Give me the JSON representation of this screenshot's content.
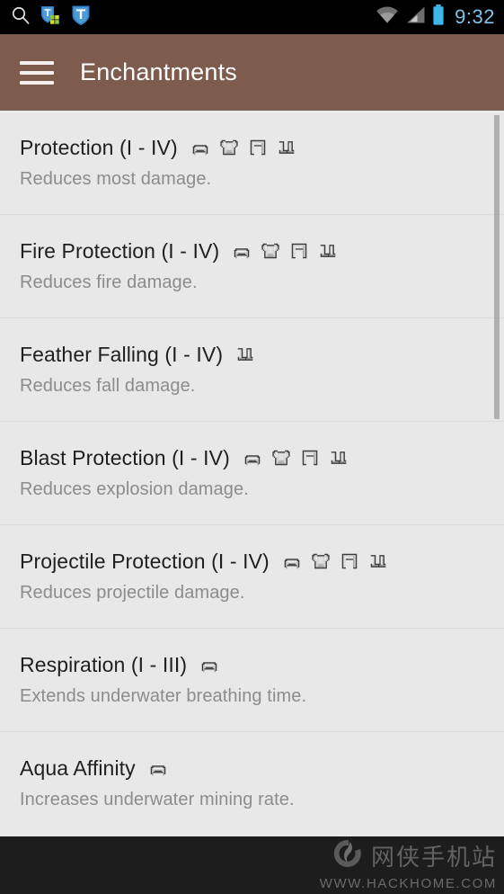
{
  "statusbar": {
    "time": "9:32",
    "left_icons": [
      "search-icon",
      "security-shield-apps-icon",
      "security-shield-icon"
    ],
    "right_icons": [
      "wifi-icon",
      "cellular-signal-icon",
      "battery-icon"
    ],
    "battery_color": "#3fb6e8",
    "clock_color": "#7fc4e8",
    "background": "#000000"
  },
  "actionbar": {
    "title": "Enchantments",
    "menu_icon": "hamburger-menu-icon",
    "background": "#7d5c4e",
    "text_color": "#ffffff"
  },
  "list": {
    "background": "#e8e8e8",
    "items": [
      {
        "title": "Protection (I - IV)",
        "description": "Reduces most damage.",
        "icons": [
          "helmet",
          "chestplate",
          "leggings",
          "boots"
        ]
      },
      {
        "title": "Fire Protection (I - IV)",
        "description": "Reduces fire damage.",
        "icons": [
          "helmet",
          "chestplate",
          "leggings",
          "boots"
        ]
      },
      {
        "title": "Feather Falling (I - IV)",
        "description": "Reduces fall damage.",
        "icons": [
          "boots"
        ]
      },
      {
        "title": "Blast Protection (I - IV)",
        "description": "Reduces explosion damage.",
        "icons": [
          "helmet",
          "chestplate",
          "leggings",
          "boots"
        ]
      },
      {
        "title": "Projectile Protection (I - IV)",
        "description": "Reduces projectile damage.",
        "icons": [
          "helmet",
          "chestplate",
          "leggings",
          "boots"
        ]
      },
      {
        "title": "Respiration (I - III)",
        "description": "Extends underwater breathing time.",
        "icons": [
          "helmet"
        ]
      },
      {
        "title": "Aqua Affinity",
        "description": "Increases underwater mining rate.",
        "icons": [
          "helmet"
        ]
      }
    ]
  },
  "scrollbar": {
    "name": "vertical-scrollbar"
  },
  "navbar": {
    "background": "#1d1d1d",
    "watermark_cn": "网侠手机站",
    "watermark_url": "WWW.HACKHOME.COM",
    "watermark_logo": "hackhome-logo-icon"
  }
}
